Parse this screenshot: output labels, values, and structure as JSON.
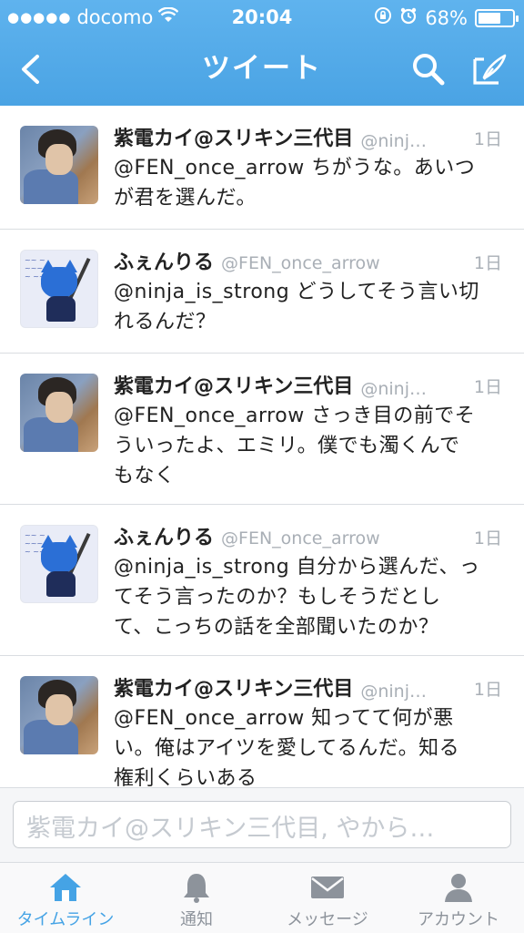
{
  "status_bar": {
    "carrier": "docomo",
    "time": "20:04",
    "battery": "68%",
    "battery_level": 0.68
  },
  "nav": {
    "title": "ツイート"
  },
  "tweets": [
    {
      "display_name": "紫電カイ@スリキン三代目",
      "handle": "@ninj…",
      "time": "1日",
      "text_line1": "@FEN_once_arrow ちがうな。あいつ",
      "text_line2": "が君を選んだ。",
      "text_line3": ""
    },
    {
      "display_name": "ふぇんりる",
      "handle": "@FEN_once_arrow",
      "time": "1日",
      "text_line1": "@ninja_is_strong どうしてそう言い切",
      "text_line2": "れるんだ？",
      "text_line3": ""
    },
    {
      "display_name": "紫電カイ@スリキン三代目",
      "handle": "@ninj…",
      "time": "1日",
      "text_line1": "@FEN_once_arrow さっき目の前でそ",
      "text_line2": "ういったよ、エミリ。僕でも濁くんで",
      "text_line3": "もなく"
    },
    {
      "display_name": "ふぇんりる",
      "handle": "@FEN_once_arrow",
      "time": "1日",
      "text_line1": "@ninja_is_strong 自分から選んだ、っ",
      "text_line2": "てそう言ったのか？もしそうだとし",
      "text_line3": "て、こっちの話を全部聞いたのか？"
    },
    {
      "display_name": "紫電カイ@スリキン三代目",
      "handle": "@ninj…",
      "time": "1日",
      "text_line1": "@FEN_once_arrow 知ってて何が悪",
      "text_line2": "い。俺はアイツを愛してるんだ。知る",
      "text_line3": "権利くらいある"
    }
  ],
  "reply": {
    "placeholder": "紫電カイ@スリキン三代目, やから…"
  },
  "tabs": [
    {
      "label": "タイムライン",
      "icon": "home-icon",
      "active": true
    },
    {
      "label": "通知",
      "icon": "bell-icon",
      "active": false
    },
    {
      "label": "メッセージ",
      "icon": "envelope-icon",
      "active": false
    },
    {
      "label": "アカウント",
      "icon": "person-icon",
      "active": false
    }
  ],
  "colors": {
    "header": "#4aa3e4",
    "active_tab": "#45a3e5",
    "inactive_tab": "#8d939b"
  }
}
